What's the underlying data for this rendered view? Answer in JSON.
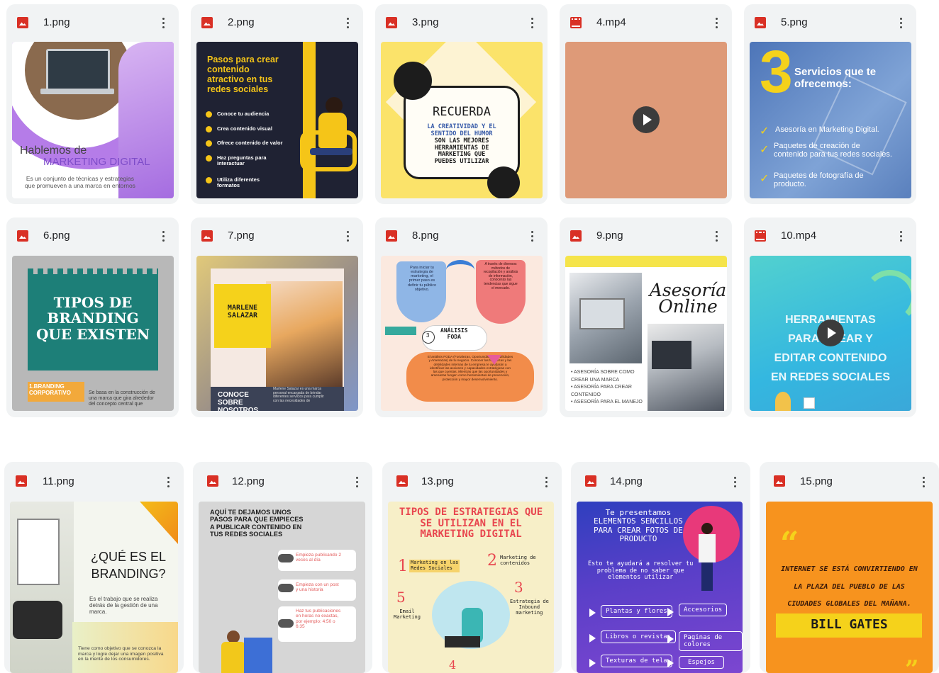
{
  "colors": {
    "image_icon": "#d93025",
    "video_icon": "#d93025",
    "card_bg": "#f1f3f4"
  },
  "files": [
    {
      "name": "1.png",
      "type": "image",
      "icon": "image-file-icon",
      "lines": [
        "Hablemos de",
        "MARKETING DIGITAL",
        "Es un conjunto de técnicas y estrategias\nque promueven a una marca en entornos"
      ]
    },
    {
      "name": "2.png",
      "type": "image",
      "icon": "image-file-icon",
      "lines": [
        "Pasos para crear\ncontenido\natractivo en tus\nredes sociales",
        "Conoce tu audiencia",
        "Crea contenido visual",
        "Ofrece contenido de valor",
        "Haz preguntas para\ninteractuar",
        "Utiliza diferentes\nformatos"
      ]
    },
    {
      "name": "3.png",
      "type": "image",
      "icon": "image-file-icon",
      "lines": [
        "RECUERDA",
        "LA CREATIVIDAD Y EL\nSENTIDO DEL HUMOR",
        "SON LAS MEJORES\nHERRAMIENTAS DE\nMARKETING QUE\nPUEDES UTILIZAR"
      ]
    },
    {
      "name": "4.mp4",
      "type": "video",
      "icon": "video-file-icon",
      "lines": []
    },
    {
      "name": "5.png",
      "type": "image",
      "icon": "image-file-icon",
      "lines": [
        "3",
        "Servicios que te\nofrecemos:",
        "Asesoría en Marketing Digital.",
        "Paquetes de creación de\ncontenido para tus redes sociales.",
        "Paquetes de fotografía de\nproducto."
      ]
    },
    {
      "name": "6.png",
      "type": "image",
      "icon": "image-file-icon",
      "lines": [
        "TIPOS DE\nBRANDING\nQUE EXISTEN",
        "1.BRANDING\nCORPORATIVO",
        "Se basa en la construcción de\nuna marca que gira alrededor\ndel concepto central que"
      ]
    },
    {
      "name": "7.png",
      "type": "image",
      "icon": "image-file-icon",
      "lines": [
        "MARLENE\nSALAZAR",
        "CONOCE\nSOBRE\nNOSOTROS",
        "Marlene Salazar es una marca\npersonal encargada de brindar\ndiferentes servicios para cumplir\ncon las necesidades de"
      ]
    },
    {
      "name": "8.png",
      "type": "image",
      "icon": "image-file-icon",
      "lines": [
        "Para iniciar tu\nestrategia de\nmarketing, el\nprimer paso es\ndefinir tu público\nobjetivo.",
        "A través de diversos\nmétodos de\nrecopilación y análisis\nde información,\nconoceràs las\ntendencias que sigue\nel mercado.",
        "ANÁLISIS\nFODA",
        "3",
        "El análisis FODA (Fortalezas, Oportunidades, Debilidades\ny Amenazas) de tu negocio. Conocer las fortalezas y las\ndebilidades internas de tu empresa te ayudarán a\nidentificar las acciones y capacidades estratégicas con\nlas que cuentas. Mientras que las oportunidades y\namenazas fungen como herramientas de prevención,\nprotección y mayor desenvolvimiento."
      ]
    },
    {
      "name": "9.png",
      "type": "image",
      "icon": "image-file-icon",
      "lines": [
        "Asesoría\nOnline",
        "• ASESORÍA SOBRE COMO\n  CREAR UNA MARCA\n•  ASESORÍA PARA CREAR\n  CONTENIDO\n• ASESORÍA PARA EL MANEJO"
      ]
    },
    {
      "name": "10.mp4",
      "type": "video",
      "icon": "video-file-icon",
      "lines": [
        "HERRAMIENTAS\nPARA CREAR Y\nEDITAR CONTENIDO\nEN REDES SOCIALES"
      ]
    },
    {
      "name": "11.png",
      "type": "image",
      "icon": "image-file-icon",
      "lines": [
        "¿QUÉ ES EL\nBRANDING?",
        "Es el trabajo que se realiza\ndetrás de la gestión de una\nmarca.",
        "Tiene como objetivo que se conozca la\nmarca y logre dejar una imagen positiva\nen la mente de los consumidores."
      ]
    },
    {
      "name": "12.png",
      "type": "image",
      "icon": "image-file-icon",
      "lines": [
        "AQUÍ TE DEJAMOS UNOS\nPASOS PARA QUE EMPIECES\nA PUBLICAR CONTENIDO EN\nTUS REDES SOCIALES",
        "Empieza publicando 2\nveces al día",
        "Empieza con un post\ny una historia",
        "Haz tus publicaciones\nen horas no exactas,\npor ejemplo: 4:50 o\n6:35"
      ]
    },
    {
      "name": "13.png",
      "type": "image",
      "icon": "image-file-icon",
      "lines": [
        "TIPOS DE ESTRATEGIAS QUE\nSE UTILIZAN EN EL\nMARKETING DIGITAL",
        "1",
        "Marketing en las\nRedes Sociales",
        "2",
        "Marketing de\ncontenidos",
        "3",
        "Estrategia de\nInbound\nmarketing",
        "5",
        "Email\nMarketing",
        "4"
      ]
    },
    {
      "name": "14.png",
      "type": "image",
      "icon": "image-file-icon",
      "lines": [
        "Te presentamos\nELEMENTOS SENCILLOS\nPARA CREAR FOTOS DE\nPRODUCTO",
        "Esto te ayudará a resolver tu\nproblema de no saber que\nelementos utilizar",
        "Plantas y flores",
        "Accesorios",
        "Libros o revistas",
        "Paginas de colores",
        "Texturas de tela",
        "Espejos"
      ]
    },
    {
      "name": "15.png",
      "type": "image",
      "icon": "image-file-icon",
      "lines": [
        "INTERNET SE ESTÁ CONVIRTIENDO EN\nLA PLAZA DEL PUEBLO DE LAS\nCIUDADES GLOBALES DEL MAÑANA.",
        "BILL GATES"
      ]
    }
  ]
}
